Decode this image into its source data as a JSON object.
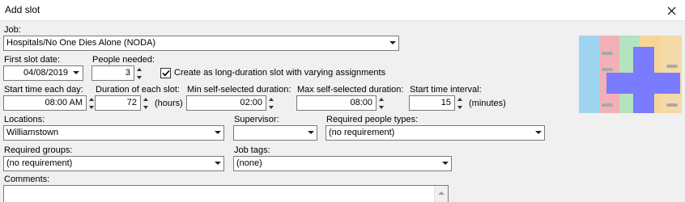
{
  "window": {
    "title": "Add slot"
  },
  "job": {
    "label": "Job:",
    "value": "Hospitals/No One Dies Alone (NODA)"
  },
  "first_slot_date": {
    "label": "First slot date:",
    "value": "04/08/2019"
  },
  "people_needed": {
    "label": "People needed:",
    "value": "3"
  },
  "long_duration": {
    "label": "Create as long-duration slot with varying assignments",
    "checked": true
  },
  "start_time": {
    "label": "Start time each day:",
    "value": "08:00 AM"
  },
  "duration": {
    "label": "Duration of each slot:",
    "value": "72",
    "unit": "(hours)"
  },
  "min_duration": {
    "label": "Min self-selected duration:",
    "value": "02:00"
  },
  "max_duration": {
    "label": "Max self-selected duration:",
    "value": "08:00"
  },
  "start_interval": {
    "label": "Start time interval:",
    "value": "15",
    "unit": "(minutes)"
  },
  "locations": {
    "label": "Locations:",
    "value": "Williamstown"
  },
  "supervisor": {
    "label": "Supervisor:",
    "value": ""
  },
  "people_types": {
    "label": "Required people types:",
    "value": "(no requirement)"
  },
  "groups": {
    "label": "Required groups:",
    "value": "(no requirement)"
  },
  "job_tags": {
    "label": "Job tags:",
    "value": "(none)"
  },
  "comments": {
    "label": "Comments:",
    "value": ""
  },
  "logo": {
    "icon": "calendar-add-icon",
    "colors": [
      "#8fd0f0",
      "#f3a6ad",
      "#a8e0b6",
      "#f7d08a",
      "#7b7bff"
    ]
  }
}
